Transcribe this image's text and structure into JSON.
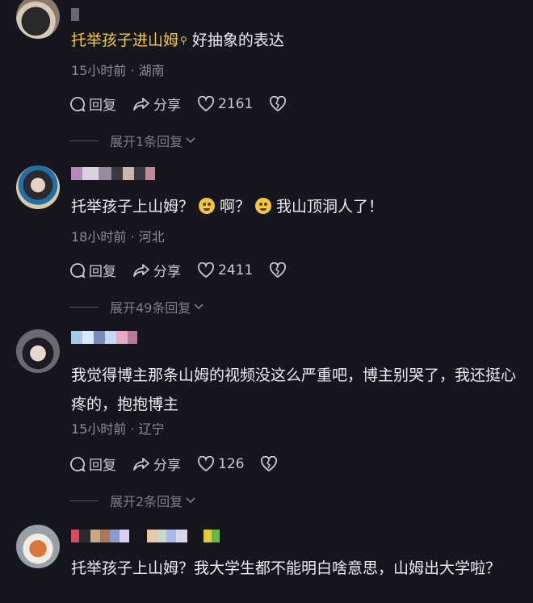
{
  "comments": [
    {
      "nick_highlight": "托举孩子进山姆",
      "text": "好抽象的表达",
      "meta": "15小时前 · 湖南",
      "reply_label": "回复",
      "share_label": "分享",
      "likes": "2161",
      "expand_label": "展开1条回复"
    },
    {
      "text_a": "托举孩子上山姆？",
      "text_b": "啊？",
      "text_c": "我山顶洞人了！",
      "meta": "18小时前 · 河北",
      "reply_label": "回复",
      "share_label": "分享",
      "likes": "2411",
      "expand_label": "展开49条回复"
    },
    {
      "text": "我觉得博主那条山姆的视频没这么严重吧，博主别哭了，我还挺心疼的，抱抱博主",
      "meta": "15小时前 · 辽宁",
      "reply_label": "回复",
      "share_label": "分享",
      "likes": "126",
      "expand_label": "展开2条回复"
    },
    {
      "text": "托举孩子上山姆？我大学生都不能明白啥意思，山姆出大学啦？"
    }
  ]
}
